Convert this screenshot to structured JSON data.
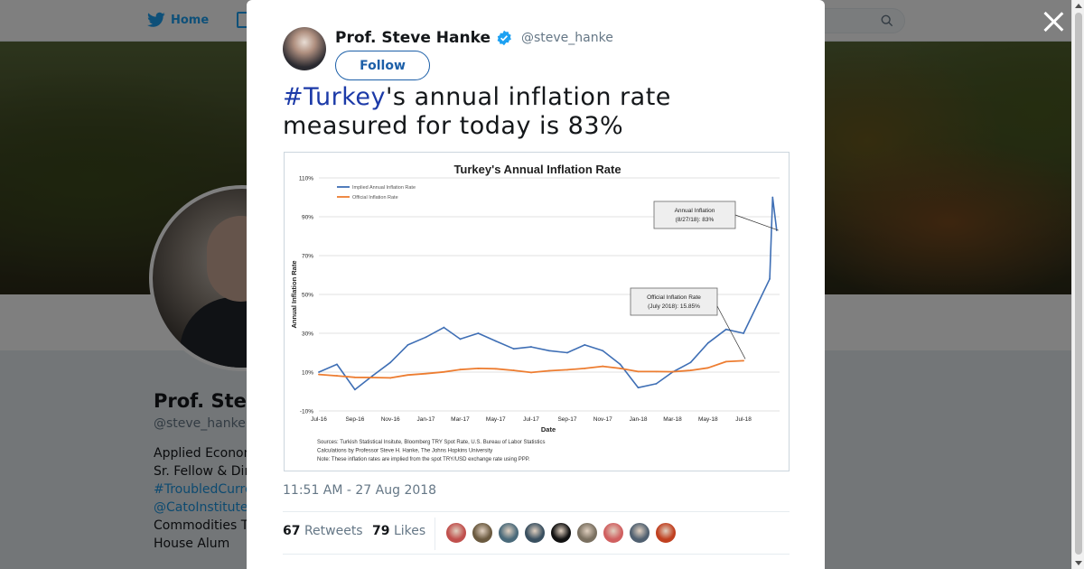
{
  "nav": {
    "home_label": "Home"
  },
  "background_profile": {
    "name": "Prof. Ste",
    "handle": "@steve_hanke",
    "bio_lines": [
      {
        "text": "Applied Econon",
        "link": false
      },
      {
        "text": "Sr. Fellow & Dir",
        "link": false
      },
      {
        "text": "#TroubledCurre",
        "link": true
      },
      {
        "text": "@CatoInstitute",
        "link": true
      },
      {
        "text": "Commodities T",
        "link": false
      },
      {
        "text": "House Alum",
        "link": false
      }
    ]
  },
  "tweet": {
    "author_name": "Prof. Steve Hanke",
    "author_handle": "@steve_hanke",
    "follow_label": "Follow",
    "text_hashtag": "#Turkey",
    "text_rest": "'s annual inflation rate measured for today is 83%",
    "timestamp": "11:51 AM - 27 Aug 2018",
    "retweets_count": "67",
    "retweets_label": "Retweets",
    "likes_count": "79",
    "likes_label": "Likes",
    "liker_avatar_colors": [
      "#c0504d",
      "#6b5a40",
      "#4a6a7a",
      "#3a5060",
      "#111111",
      "#7a7060",
      "#d06060",
      "#506070",
      "#c04020"
    ]
  },
  "colors": {
    "implied": "#3f6fb5",
    "official": "#ed7d31",
    "link": "#1b95e0",
    "twitter_blue": "#1da1f2"
  },
  "chart_data": {
    "type": "line",
    "title": "Turkey's Annual Inflation Rate",
    "xlabel": "Date",
    "ylabel": "Annual Inflation Rate",
    "x_ticks": [
      "Jul-16",
      "Sep-16",
      "Nov-16",
      "Jan-17",
      "Mar-17",
      "May-17",
      "Jul-17",
      "Sep-17",
      "Nov-17",
      "Jan-18",
      "Mar-18",
      "May-18",
      "Jul-18"
    ],
    "y_ticks": [
      "-10%",
      "10%",
      "30%",
      "50%",
      "70%",
      "90%",
      "110%"
    ],
    "ylim": [
      -10,
      110
    ],
    "grid": true,
    "legend_position": "top-left",
    "series": [
      {
        "name": "Implied Annual Inflation Rate",
        "x": [
          "2016-07",
          "2016-08",
          "2016-09",
          "2016-10",
          "2016-11",
          "2016-12",
          "2017-01",
          "2017-02",
          "2017-03",
          "2017-04",
          "2017-05",
          "2017-06",
          "2017-07",
          "2017-08",
          "2017-09",
          "2017-10",
          "2017-11",
          "2017-12",
          "2018-01",
          "2018-02",
          "2018-03",
          "2018-04",
          "2018-05",
          "2018-06",
          "2018-07",
          "2018-08-15",
          "2018-08-20",
          "2018-08-27"
        ],
        "values": [
          10,
          14,
          1,
          8,
          15,
          24,
          28,
          33,
          27,
          30,
          26,
          22,
          23,
          21,
          20,
          24,
          21,
          14,
          2,
          4,
          10,
          15,
          25,
          32,
          30,
          58,
          100,
          83
        ]
      },
      {
        "name": "Official Inflation Rate",
        "x": [
          "2016-07",
          "2016-08",
          "2016-09",
          "2016-10",
          "2016-11",
          "2016-12",
          "2017-01",
          "2017-02",
          "2017-03",
          "2017-04",
          "2017-05",
          "2017-06",
          "2017-07",
          "2017-08",
          "2017-09",
          "2017-10",
          "2017-11",
          "2017-12",
          "2018-01",
          "2018-02",
          "2018-03",
          "2018-04",
          "2018-05",
          "2018-06",
          "2018-07"
        ],
        "values": [
          8.8,
          8.1,
          7.3,
          7.2,
          7.0,
          8.5,
          9.2,
          10.1,
          11.3,
          11.9,
          11.7,
          10.9,
          9.8,
          10.7,
          11.2,
          11.9,
          13.0,
          11.9,
          10.3,
          10.3,
          10.2,
          10.9,
          12.2,
          15.4,
          15.85
        ]
      }
    ],
    "annotations": [
      {
        "text_line1": "Annual Inflation",
        "text_line2": "(8/27/18): 83%"
      },
      {
        "text_line1": "Official Inflation Rate",
        "text_line2": "(July 2018): 15.85%"
      }
    ],
    "footnotes": [
      "Sources: Turkish Statistical Insitute, Bloomberg TRY Spot Rate, U.S. Bureau of Labor Statistics",
      "Calculations by Professor Steve H. Hanke, The Johns Hopkins University",
      "Note: These inflation rates are implied from the spot TRY/USD exchange rate using PPP."
    ]
  }
}
